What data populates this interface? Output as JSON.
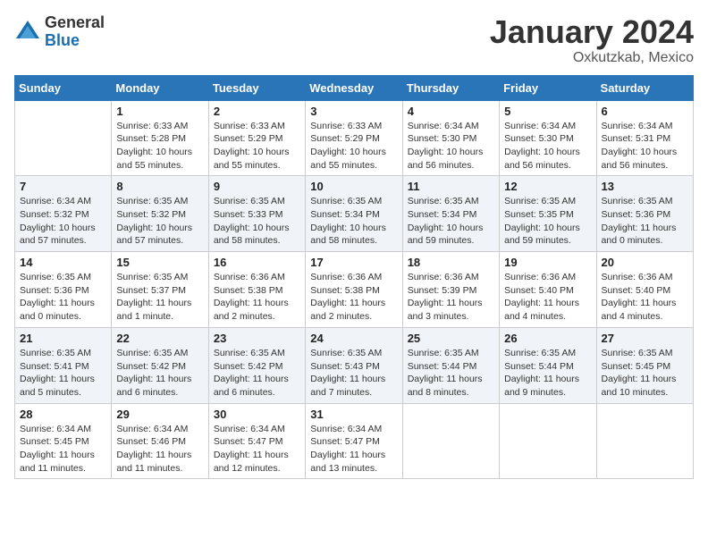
{
  "logo": {
    "general": "General",
    "blue": "Blue"
  },
  "title": "January 2024",
  "location": "Oxkutzkab, Mexico",
  "headers": [
    "Sunday",
    "Monday",
    "Tuesday",
    "Wednesday",
    "Thursday",
    "Friday",
    "Saturday"
  ],
  "weeks": [
    [
      {
        "day": "",
        "info": ""
      },
      {
        "day": "1",
        "info": "Sunrise: 6:33 AM\nSunset: 5:28 PM\nDaylight: 10 hours\nand 55 minutes."
      },
      {
        "day": "2",
        "info": "Sunrise: 6:33 AM\nSunset: 5:29 PM\nDaylight: 10 hours\nand 55 minutes."
      },
      {
        "day": "3",
        "info": "Sunrise: 6:33 AM\nSunset: 5:29 PM\nDaylight: 10 hours\nand 55 minutes."
      },
      {
        "day": "4",
        "info": "Sunrise: 6:34 AM\nSunset: 5:30 PM\nDaylight: 10 hours\nand 56 minutes."
      },
      {
        "day": "5",
        "info": "Sunrise: 6:34 AM\nSunset: 5:30 PM\nDaylight: 10 hours\nand 56 minutes."
      },
      {
        "day": "6",
        "info": "Sunrise: 6:34 AM\nSunset: 5:31 PM\nDaylight: 10 hours\nand 56 minutes."
      }
    ],
    [
      {
        "day": "7",
        "info": "Sunrise: 6:34 AM\nSunset: 5:32 PM\nDaylight: 10 hours\nand 57 minutes."
      },
      {
        "day": "8",
        "info": "Sunrise: 6:35 AM\nSunset: 5:32 PM\nDaylight: 10 hours\nand 57 minutes."
      },
      {
        "day": "9",
        "info": "Sunrise: 6:35 AM\nSunset: 5:33 PM\nDaylight: 10 hours\nand 58 minutes."
      },
      {
        "day": "10",
        "info": "Sunrise: 6:35 AM\nSunset: 5:34 PM\nDaylight: 10 hours\nand 58 minutes."
      },
      {
        "day": "11",
        "info": "Sunrise: 6:35 AM\nSunset: 5:34 PM\nDaylight: 10 hours\nand 59 minutes."
      },
      {
        "day": "12",
        "info": "Sunrise: 6:35 AM\nSunset: 5:35 PM\nDaylight: 10 hours\nand 59 minutes."
      },
      {
        "day": "13",
        "info": "Sunrise: 6:35 AM\nSunset: 5:36 PM\nDaylight: 11 hours\nand 0 minutes."
      }
    ],
    [
      {
        "day": "14",
        "info": "Sunrise: 6:35 AM\nSunset: 5:36 PM\nDaylight: 11 hours\nand 0 minutes."
      },
      {
        "day": "15",
        "info": "Sunrise: 6:35 AM\nSunset: 5:37 PM\nDaylight: 11 hours\nand 1 minute."
      },
      {
        "day": "16",
        "info": "Sunrise: 6:36 AM\nSunset: 5:38 PM\nDaylight: 11 hours\nand 2 minutes."
      },
      {
        "day": "17",
        "info": "Sunrise: 6:36 AM\nSunset: 5:38 PM\nDaylight: 11 hours\nand 2 minutes."
      },
      {
        "day": "18",
        "info": "Sunrise: 6:36 AM\nSunset: 5:39 PM\nDaylight: 11 hours\nand 3 minutes."
      },
      {
        "day": "19",
        "info": "Sunrise: 6:36 AM\nSunset: 5:40 PM\nDaylight: 11 hours\nand 4 minutes."
      },
      {
        "day": "20",
        "info": "Sunrise: 6:36 AM\nSunset: 5:40 PM\nDaylight: 11 hours\nand 4 minutes."
      }
    ],
    [
      {
        "day": "21",
        "info": "Sunrise: 6:35 AM\nSunset: 5:41 PM\nDaylight: 11 hours\nand 5 minutes."
      },
      {
        "day": "22",
        "info": "Sunrise: 6:35 AM\nSunset: 5:42 PM\nDaylight: 11 hours\nand 6 minutes."
      },
      {
        "day": "23",
        "info": "Sunrise: 6:35 AM\nSunset: 5:42 PM\nDaylight: 11 hours\nand 6 minutes."
      },
      {
        "day": "24",
        "info": "Sunrise: 6:35 AM\nSunset: 5:43 PM\nDaylight: 11 hours\nand 7 minutes."
      },
      {
        "day": "25",
        "info": "Sunrise: 6:35 AM\nSunset: 5:44 PM\nDaylight: 11 hours\nand 8 minutes."
      },
      {
        "day": "26",
        "info": "Sunrise: 6:35 AM\nSunset: 5:44 PM\nDaylight: 11 hours\nand 9 minutes."
      },
      {
        "day": "27",
        "info": "Sunrise: 6:35 AM\nSunset: 5:45 PM\nDaylight: 11 hours\nand 10 minutes."
      }
    ],
    [
      {
        "day": "28",
        "info": "Sunrise: 6:34 AM\nSunset: 5:45 PM\nDaylight: 11 hours\nand 11 minutes."
      },
      {
        "day": "29",
        "info": "Sunrise: 6:34 AM\nSunset: 5:46 PM\nDaylight: 11 hours\nand 11 minutes."
      },
      {
        "day": "30",
        "info": "Sunrise: 6:34 AM\nSunset: 5:47 PM\nDaylight: 11 hours\nand 12 minutes."
      },
      {
        "day": "31",
        "info": "Sunrise: 6:34 AM\nSunset: 5:47 PM\nDaylight: 11 hours\nand 13 minutes."
      },
      {
        "day": "",
        "info": ""
      },
      {
        "day": "",
        "info": ""
      },
      {
        "day": "",
        "info": ""
      }
    ]
  ]
}
